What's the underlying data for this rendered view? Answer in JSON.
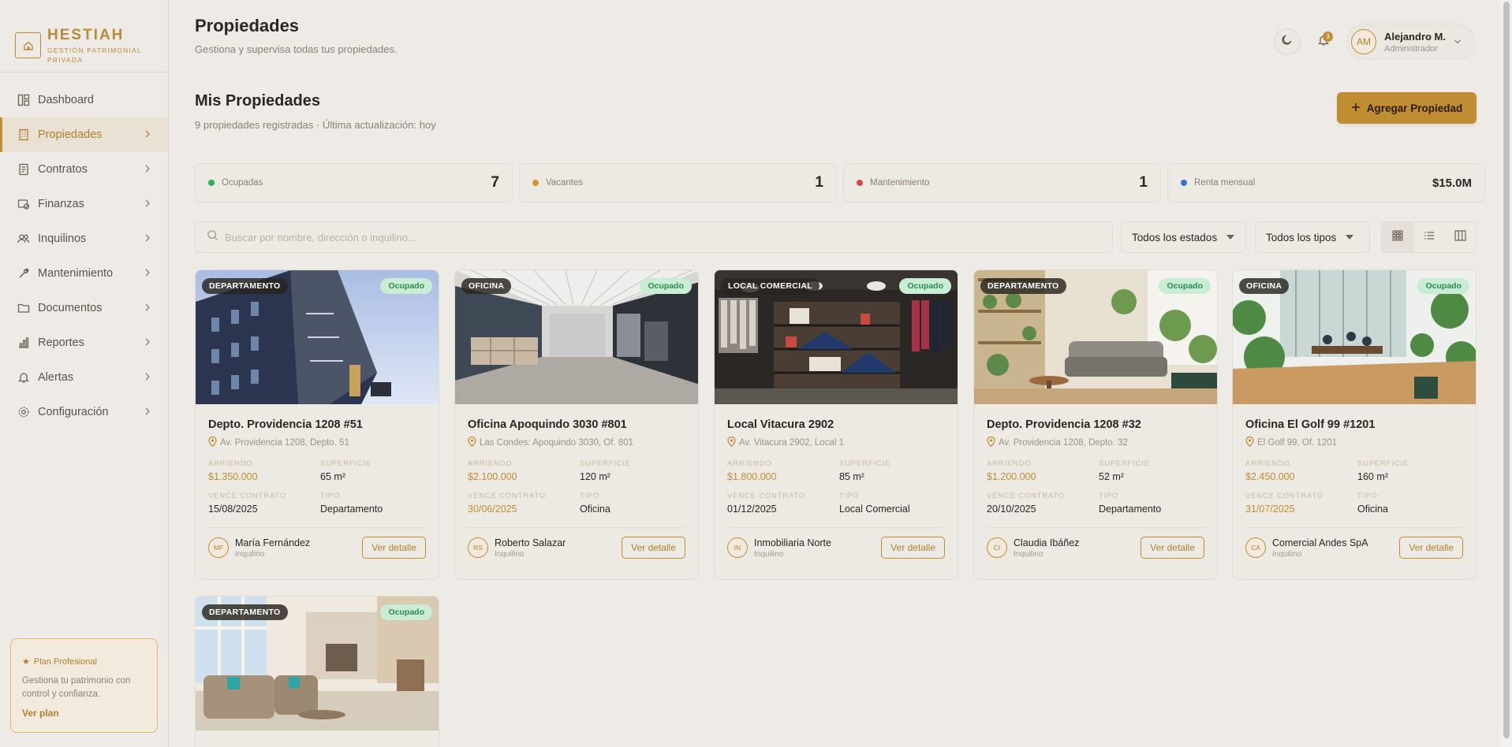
{
  "brand": {
    "name": "HESTIAH",
    "tagline": "GESTIÓN PATRIMONIAL PRIVADA"
  },
  "nav": [
    {
      "label": "Dashboard",
      "icon": "dashboard-icon",
      "active": false
    },
    {
      "label": "Propiedades",
      "icon": "building-icon",
      "active": true
    },
    {
      "label": "Contratos",
      "icon": "document-icon",
      "active": false
    },
    {
      "label": "Finanzas",
      "icon": "wallet-icon",
      "active": false
    },
    {
      "label": "Inquilinos",
      "icon": "users-icon",
      "active": false
    },
    {
      "label": "Mantenimiento",
      "icon": "wrench-icon",
      "active": false
    },
    {
      "label": "Documentos",
      "icon": "folder-icon",
      "active": false
    },
    {
      "label": "Reportes",
      "icon": "bar-chart-icon",
      "active": false
    },
    {
      "label": "Alertas",
      "icon": "bell-icon",
      "active": false
    },
    {
      "label": "Configuración",
      "icon": "gear-icon",
      "active": false
    }
  ],
  "plan": {
    "title": "Plan Profesional",
    "description": "Gestiona tu patrimonio con control y confianza.",
    "link": "Ver plan"
  },
  "header": {
    "title": "Propiedades",
    "subtitle": "Gestiona y supervisa todas tus propiedades.",
    "notifications": "3",
    "user": {
      "initials": "AM",
      "name": "Alejandro M.",
      "role": "Administrador"
    }
  },
  "section": {
    "title": "Mis Propiedades",
    "subtitle": "9 propiedades registradas · Última actualización: hoy",
    "add_label": "Agregar Propiedad"
  },
  "stats": [
    {
      "label": "Ocupadas",
      "value": "7",
      "color": "#2fae5e"
    },
    {
      "label": "Vacantes",
      "value": "1",
      "color": "#d6952c"
    },
    {
      "label": "Mantenimiento",
      "value": "1",
      "color": "#d9474b"
    },
    {
      "label": "Renta mensual",
      "value": "$15.0M",
      "color": "#3a6fd6"
    }
  ],
  "filters": {
    "search_placeholder": "Buscar por nombre, dirección o inquilino...",
    "status": "Todos los estados",
    "type": "Todos los tipos"
  },
  "labels": {
    "rent": "ARRIENDO",
    "area": "SUPERFICIE",
    "contract_end": "VENCE CONTRATO",
    "type": "TIPO",
    "tenant_role": "Inquilino",
    "detail": "Ver detalle"
  },
  "properties": [
    {
      "badge": "DEPARTAMENTO",
      "status": "Ocupado",
      "title": "Depto. Providencia 1208 #51",
      "address": "Av. Providencia 1208, Depto. 51",
      "rent": "$1.350.000",
      "area": "65 m²",
      "contract_end": "15/08/2025",
      "contract_warn": false,
      "type": "Departamento",
      "tenant_initials": "MF",
      "tenant": "María Fernández"
    },
    {
      "badge": "OFICINA",
      "status": "Ocupado",
      "title": "Oficina Apoquindo 3030 #801",
      "address": "Las Condes: Apoquindo 3030, Of. 801",
      "rent": "$2.100.000",
      "area": "120 m²",
      "contract_end": "30/06/2025",
      "contract_warn": true,
      "type": "Oficina",
      "tenant_initials": "RS",
      "tenant": "Roberto Salazar"
    },
    {
      "badge": "LOCAL COMERCIAL",
      "status": "Ocupado",
      "title": "Local Vitacura 2902",
      "address": "Av. Vitacura 2902, Local 1",
      "rent": "$1.800.000",
      "area": "85 m²",
      "contract_end": "01/12/2025",
      "contract_warn": false,
      "type": "Local Comercial",
      "tenant_initials": "IN",
      "tenant": "Inmobiliaria Norte"
    },
    {
      "badge": "DEPARTAMENTO",
      "status": "Ocupado",
      "title": "Depto. Providencia 1208 #32",
      "address": "Av. Providencia 1208, Depto. 32",
      "rent": "$1.200.000",
      "area": "52 m²",
      "contract_end": "20/10/2025",
      "contract_warn": false,
      "type": "Departamento",
      "tenant_initials": "CI",
      "tenant": "Claudia Ibáñez"
    },
    {
      "badge": "OFICINA",
      "status": "Ocupado",
      "title": "Oficina El Golf 99 #1201",
      "address": "El Golf 99, Of. 1201",
      "rent": "$2.450.000",
      "area": "160 m²",
      "contract_end": "31/07/2025",
      "contract_warn": true,
      "type": "Oficina",
      "tenant_initials": "CA",
      "tenant": "Comercial Andes SpA"
    },
    {
      "badge": "DEPARTAMENTO",
      "status": "Ocupado"
    }
  ]
}
